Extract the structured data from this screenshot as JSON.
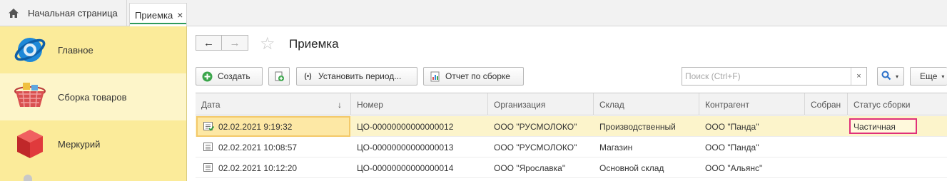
{
  "tabs": {
    "home_label": "Начальная страница",
    "active_label": "Приемка",
    "close_glyph": "×"
  },
  "sidebar": {
    "items": [
      {
        "label": "Главное",
        "icon": "globe-icon"
      },
      {
        "label": "Сборка товаров",
        "icon": "basket-icon"
      },
      {
        "label": "Меркурий",
        "icon": "red-cube-icon"
      }
    ]
  },
  "header": {
    "title": "Приемка",
    "back_glyph": "←",
    "forward_glyph": "→",
    "star_glyph": "☆"
  },
  "toolbar": {
    "create_label": "Создать",
    "set_period_label": "Установить период...",
    "report_label": "Отчет по сборке",
    "search_placeholder": "Поиск (Ctrl+F)",
    "clear_glyph": "×",
    "more_label": "Еще"
  },
  "table": {
    "sort_glyph": "↓",
    "columns": [
      "Дата",
      "Номер",
      "Организация",
      "Склад",
      "Контрагент",
      "Собран",
      "Статус сборки"
    ],
    "rows": [
      {
        "date": "02.02.2021 9:19:32",
        "number": "ЦО-00000000000000012",
        "org": "ООО \"РУСМОЛОКО\"",
        "warehouse": "Производственный",
        "partner": "ООО \"Панда\"",
        "collected": "",
        "status": "Частичная"
      },
      {
        "date": "02.02.2021 10:08:57",
        "number": "ЦО-00000000000000013",
        "org": "ООО \"РУСМОЛОКО\"",
        "warehouse": "Магазин",
        "partner": "ООО \"Панда\"",
        "collected": "",
        "status": ""
      },
      {
        "date": "02.02.2021 10:12:20",
        "number": "ЦО-00000000000000014",
        "org": "ООО \"Ярославка\"",
        "warehouse": "Основной склад",
        "partner": "ООО \"Альянс\"",
        "collected": "",
        "status": ""
      }
    ]
  },
  "colors": {
    "sidebar_bg": "#fbeb9a",
    "selected_row": "#fcf4cb",
    "status_highlight": "#e0307a",
    "active_tab_underline": "#2e9b5b"
  }
}
